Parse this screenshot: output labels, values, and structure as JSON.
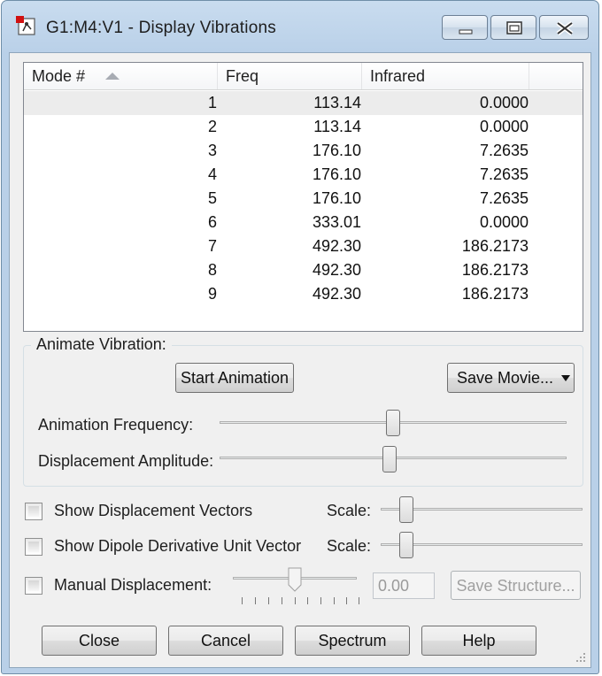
{
  "window": {
    "title": "G1:M4:V1 - Display Vibrations"
  },
  "table": {
    "columns": [
      "Mode #",
      "Freq",
      "Infrared"
    ],
    "rows": [
      [
        "1",
        "113.14",
        "0.0000"
      ],
      [
        "2",
        "113.14",
        "0.0000"
      ],
      [
        "3",
        "176.10",
        "7.2635"
      ],
      [
        "4",
        "176.10",
        "7.2635"
      ],
      [
        "5",
        "176.10",
        "7.2635"
      ],
      [
        "6",
        "333.01",
        "0.0000"
      ],
      [
        "7",
        "492.30",
        "186.2173"
      ],
      [
        "8",
        "492.30",
        "186.2173"
      ],
      [
        "9",
        "492.30",
        "186.2173"
      ]
    ],
    "selected_row": 1
  },
  "animate": {
    "group_label": "Animate Vibration:",
    "start_label": "Start Animation",
    "save_movie_label": "Save Movie...",
    "frequency_label": "Animation Frequency:",
    "frequency_level": 0.5,
    "amplitude_label": "Displacement Amplitude:",
    "amplitude_level": 0.49
  },
  "options": {
    "show_vectors_label": "Show Displacement Vectors",
    "show_vectors_checked": false,
    "vectors_scale_label": "Scale:",
    "vectors_scale_level": 0.1,
    "show_dipole_label": "Show Dipole Derivative Unit Vector",
    "show_dipole_checked": false,
    "dipole_scale_label": "Scale:",
    "dipole_scale_level": 0.1,
    "manual_label": "Manual Displacement:",
    "manual_checked": false,
    "manual_level": 0.5,
    "manual_value": "0.00",
    "save_structure_label": "Save Structure..."
  },
  "buttons": {
    "close": "Close",
    "cancel": "Cancel",
    "spectrum": "Spectrum",
    "help": "Help"
  }
}
